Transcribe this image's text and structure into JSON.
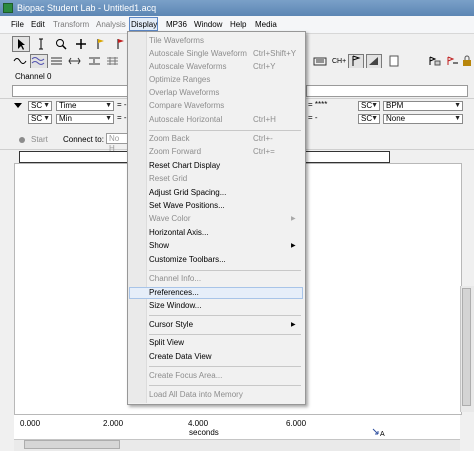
{
  "window": {
    "title": "Biopac Student Lab - Untitled1.acq"
  },
  "menubar": {
    "items": [
      {
        "label": "File",
        "disabled": false
      },
      {
        "label": "Edit",
        "disabled": false
      },
      {
        "label": "Transform",
        "disabled": true
      },
      {
        "label": "Analysis",
        "disabled": true
      },
      {
        "label": "Display",
        "disabled": false
      },
      {
        "label": "MP36",
        "disabled": false
      },
      {
        "label": "Window",
        "disabled": false
      },
      {
        "label": "Help",
        "disabled": false
      },
      {
        "label": "Media",
        "disabled": false
      }
    ]
  },
  "toolbar": {
    "chn_label": "CH+"
  },
  "channel": {
    "label": "Channel 0"
  },
  "measurements": {
    "row1": {
      "channel": "SC",
      "measure": "Time",
      "value": "****",
      "right_channel": "SC",
      "right_measure": "BPM"
    },
    "row2": {
      "channel": "SC",
      "measure": "Min",
      "right_channel": "SC",
      "right_measure": "None"
    }
  },
  "start_row": {
    "start_label": "Start",
    "connect_label": "Connect to:",
    "connect_value": "No H"
  },
  "time_axis": {
    "ticks": [
      "0.000",
      "2.000",
      "4.000",
      "6.000"
    ],
    "unit": "seconds"
  },
  "display_menu": {
    "items": [
      {
        "label": "Tile Waveforms",
        "disabled": true
      },
      {
        "label": "Autoscale Single Waveform",
        "shortcut": "Ctrl+Shift+Y",
        "disabled": true
      },
      {
        "label": "Autoscale Waveforms",
        "shortcut": "Ctrl+Y",
        "disabled": true
      },
      {
        "label": "Optimize Ranges",
        "disabled": true
      },
      {
        "label": "Overlap Waveforms",
        "disabled": true
      },
      {
        "label": "Compare Waveforms",
        "disabled": true
      },
      {
        "label": "Autoscale Horizontal",
        "shortcut": "Ctrl+H",
        "disabled": true
      },
      {
        "label": "Zoom Back",
        "shortcut": "Ctrl+-",
        "disabled": true
      },
      {
        "label": "Zoom Forward",
        "shortcut": "Ctrl+=",
        "disabled": true
      },
      {
        "label": "Reset Chart Display",
        "disabled": false
      },
      {
        "label": "Reset Grid",
        "disabled": true
      },
      {
        "label": "Adjust Grid Spacing...",
        "disabled": false
      },
      {
        "label": "Set Wave Positions...",
        "disabled": false
      },
      {
        "label": "Wave Color",
        "disabled": true,
        "submenu": true
      },
      {
        "label": "Horizontal Axis...",
        "disabled": false
      },
      {
        "label": "Show",
        "disabled": false,
        "submenu": true
      },
      {
        "label": "Customize Toolbars...",
        "disabled": false
      },
      {
        "label": "Channel Info...",
        "disabled": true
      },
      {
        "label": "Preferences...",
        "disabled": false,
        "highlighted": true
      },
      {
        "label": "Size Window...",
        "disabled": false
      },
      {
        "label": "Cursor Style",
        "disabled": false,
        "submenu": true
      },
      {
        "label": "Split View",
        "disabled": false
      },
      {
        "label": "Create Data View",
        "disabled": false
      },
      {
        "label": "Create Focus Area...",
        "disabled": true
      },
      {
        "label": "Load All Data into Memory",
        "disabled": true
      }
    ]
  }
}
